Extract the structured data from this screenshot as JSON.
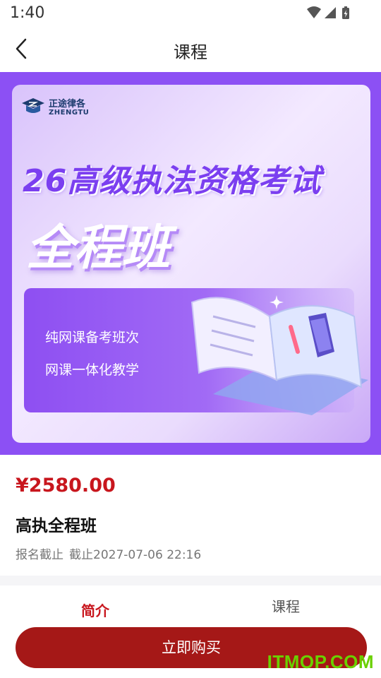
{
  "status_bar": {
    "time": "1:40"
  },
  "nav": {
    "title": "课程"
  },
  "banner": {
    "logo_cn": "正途律各",
    "logo_en": "ZHENGTU",
    "headline_1": "26高级执法资格考试",
    "headline_2": "全程班",
    "tags": [
      "纯网课备考班次",
      "网课一体化教学"
    ]
  },
  "course": {
    "price": "¥2580.00",
    "title": "高执全程班",
    "deadline_label": "报名截止",
    "deadline_value": "截止2027-07-06 22:16"
  },
  "tabs": [
    {
      "label": "简介",
      "active": true
    },
    {
      "label": "课程",
      "active": false
    }
  ],
  "actions": {
    "buy_label": "立即购买"
  },
  "watermark": "ITMOP.COM",
  "colors": {
    "accent": "#c8161d",
    "buy_button": "#a51817",
    "banner_bg": "#8c50f4"
  }
}
